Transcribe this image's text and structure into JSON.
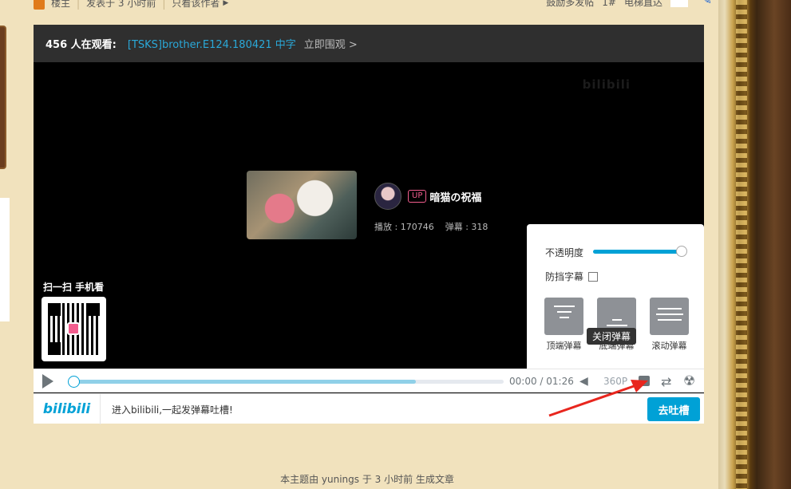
{
  "topbar": {
    "floor_owner": "楼主",
    "posted": "发表于 3 小时前",
    "only_author": "只看该作者",
    "reward": "鼓励多发帖",
    "floor": "1#",
    "elevator": "电梯直达"
  },
  "player": {
    "viewer_count": "456 人在观看:",
    "video_title": "[TSKS]brother.E124.180421 中字",
    "watch_now": "立即围观 >",
    "watermark": "bilibili",
    "up_badge": "UP",
    "uploader": "暗猫の祝福",
    "plays": "播放 : 170746",
    "danmaku_count": "弹幕 : 318",
    "qr_label": "扫一扫 手机看"
  },
  "settings": {
    "opacity_label": "不透明度",
    "block_subtitle_label": "防挡字幕",
    "modes": [
      "顶端弹幕",
      "底端弹幕",
      "滚动弹幕"
    ],
    "opacity": 1.0
  },
  "tooltip": "关闭弹幕",
  "controls": {
    "time": "00:00 / 01:26",
    "quality": "360P",
    "progress": 0.0,
    "buffered": 0.8
  },
  "sendbar": {
    "logo": "bilibili",
    "placeholder": "进入bilibili,一起发弹幕吐槽!",
    "send": "去吐槽"
  },
  "footer": "本主题由 yunings 于 3 小时前 生成文章",
  "colors": {
    "accent": "#00a1d6",
    "pink": "#f25d8e",
    "arrow": "#e8261e"
  }
}
